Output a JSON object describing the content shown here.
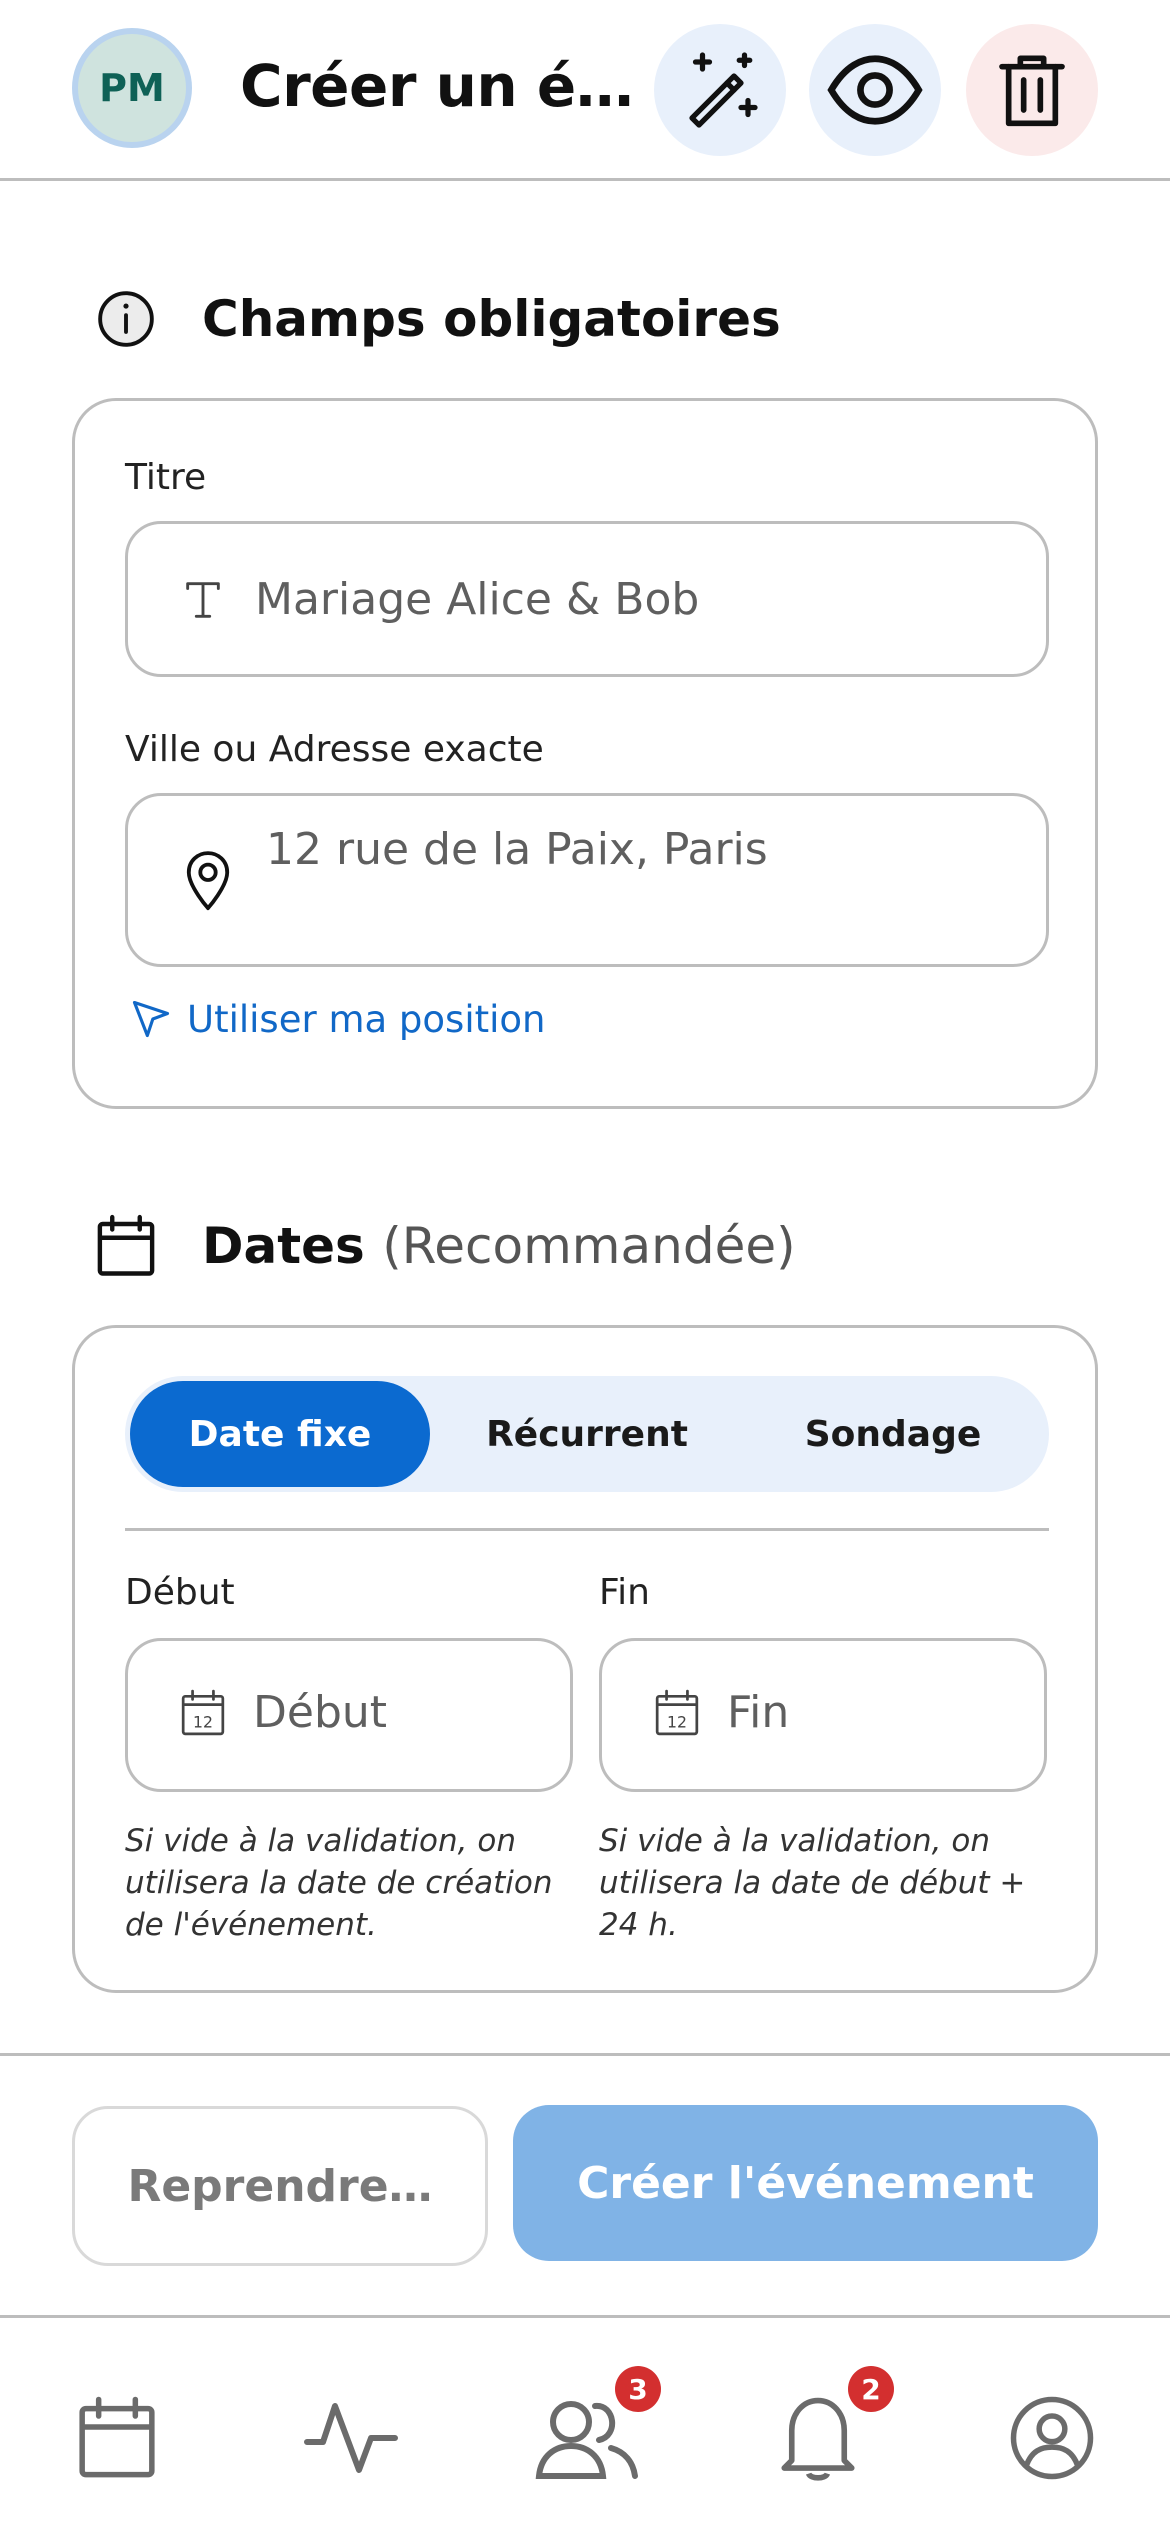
{
  "header": {
    "avatar_initials": "PM",
    "title": "Créer un é…",
    "icons": {
      "magic": "magic-wand-icon",
      "preview": "eye-icon",
      "delete": "trash-icon"
    },
    "colors": {
      "avatar_bg": "#cfe3de",
      "avatar_text": "#0f6156",
      "action_bg": "#e8f0fb",
      "delete_bg": "#fbeaea"
    }
  },
  "required_section": {
    "title": "Champs obligatoires",
    "icon": "info-icon",
    "title_field": {
      "label": "Titre",
      "placeholder": "Mariage Alice & Bob",
      "icon": "text-icon"
    },
    "address_field": {
      "label": "Ville ou Adresse exacte",
      "placeholder": "12 rue de la Paix, Paris",
      "icon": "map-pin-icon"
    },
    "use_position_link": "Utiliser ma position"
  },
  "dates_section": {
    "title": "Dates",
    "subtitle": "(Recommandée)",
    "icon": "calendar-icon",
    "tabs": [
      {
        "label": "Date fixe",
        "active": true
      },
      {
        "label": "Récurrent",
        "active": false
      },
      {
        "label": "Sondage",
        "active": false
      }
    ],
    "start": {
      "label": "Début",
      "placeholder": "Début",
      "hint": "Si vide à la validation, on utilisera la date de création de l'événement."
    },
    "end": {
      "label": "Fin",
      "placeholder": "Fin",
      "hint": "Si vide à la validation, on utilisera la date de début + 24 h."
    },
    "calendar_day": "12"
  },
  "actions": {
    "resume_label": "Reprendre…",
    "create_label": "Créer l'événement",
    "primary_color": "#80b3e6"
  },
  "nav": {
    "items": [
      {
        "name": "calendar-icon",
        "badge": ""
      },
      {
        "name": "activity-icon",
        "badge": ""
      },
      {
        "name": "users-icon",
        "badge": "3"
      },
      {
        "name": "bell-icon",
        "badge": "2"
      },
      {
        "name": "profile-icon",
        "badge": ""
      }
    ],
    "badge_color": "#d32f2f"
  }
}
